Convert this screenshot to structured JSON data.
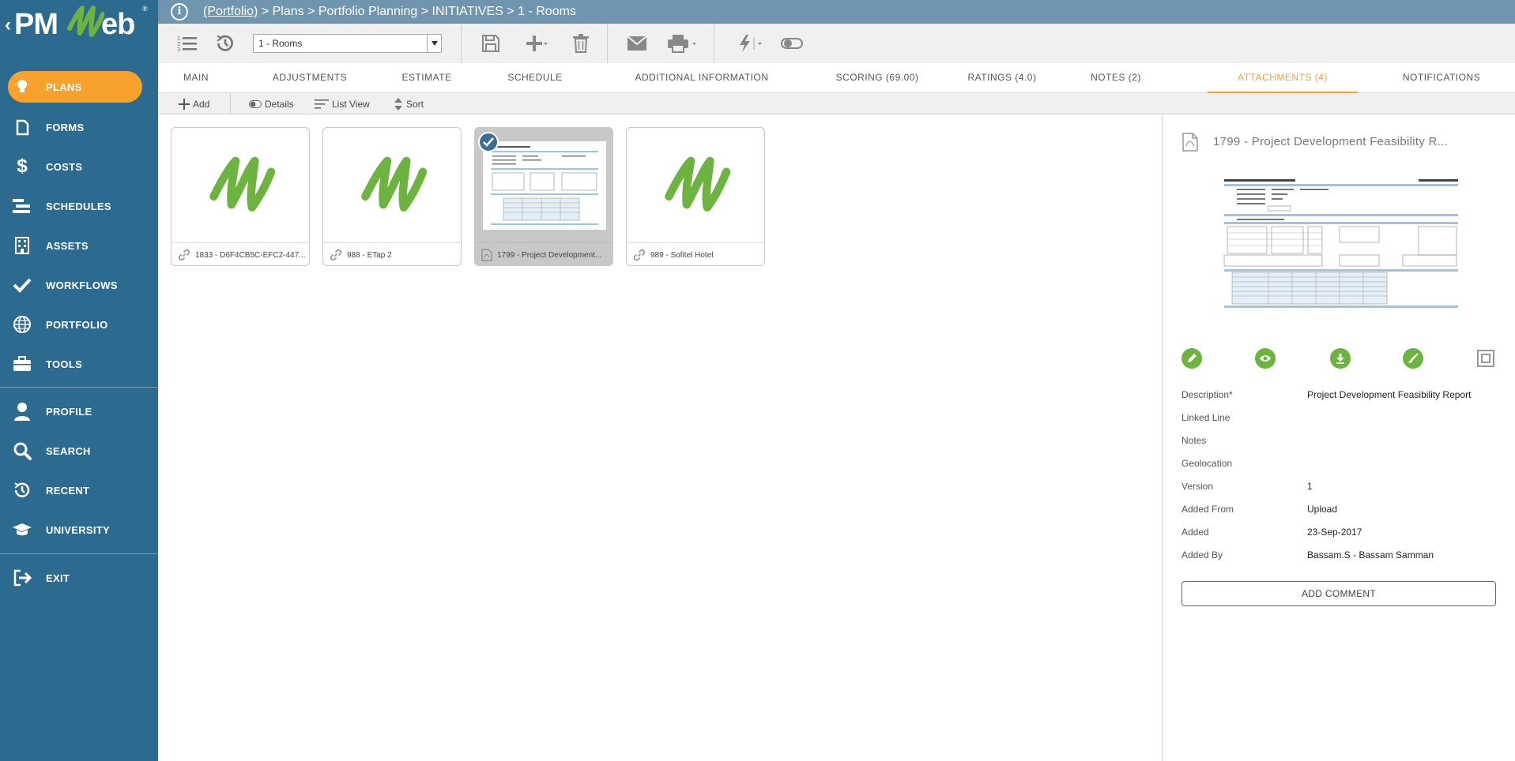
{
  "app": {
    "logo_text_left": "PM",
    "logo_text_right": "eb",
    "logo_reg": "®"
  },
  "sidebar": {
    "items": [
      {
        "label": "PLANS",
        "icon": "lightbulb-icon",
        "active": true
      },
      {
        "label": "FORMS",
        "icon": "document-icon"
      },
      {
        "label": "COSTS",
        "icon": "dollar-icon"
      },
      {
        "label": "SCHEDULES",
        "icon": "gantt-icon"
      },
      {
        "label": "ASSETS",
        "icon": "building-icon"
      },
      {
        "label": "WORKFLOWS",
        "icon": "check-icon"
      },
      {
        "label": "PORTFOLIO",
        "icon": "globe-icon"
      },
      {
        "label": "TOOLS",
        "icon": "toolbox-icon"
      },
      {
        "label": "PROFILE",
        "icon": "user-icon"
      },
      {
        "label": "SEARCH",
        "icon": "search-icon"
      },
      {
        "label": "RECENT",
        "icon": "history-icon"
      },
      {
        "label": "UNIVERSITY",
        "icon": "graduation-cap-icon"
      },
      {
        "label": "EXIT",
        "icon": "exit-icon"
      }
    ]
  },
  "breadcrumb": {
    "link": "(Portfolio)",
    "rest": " > Plans > Portfolio Planning > INITIATIVES > 1 - Rooms"
  },
  "toolbar": {
    "record_selected": "1 - Rooms"
  },
  "tabs": [
    {
      "label": "MAIN"
    },
    {
      "label": "ADJUSTMENTS"
    },
    {
      "label": "ESTIMATE"
    },
    {
      "label": "SCHEDULE"
    },
    {
      "label": "ADDITIONAL INFORMATION"
    },
    {
      "label": "SCORING (69.00)"
    },
    {
      "label": "RATINGS (4.0)"
    },
    {
      "label": "NOTES (2)"
    },
    {
      "label": "ATTACHMENTS (4)",
      "active": true
    },
    {
      "label": "NOTIFICATIONS"
    }
  ],
  "subtoolbar": {
    "add": "Add",
    "details": "Details",
    "list_view": "List View",
    "sort": "Sort"
  },
  "attachments": [
    {
      "name": "1833 - D6F4CB5C-EFC2-447...",
      "type": "link"
    },
    {
      "name": "988 - ETap 2",
      "type": "link"
    },
    {
      "name": "1799 - Project Development...",
      "type": "file",
      "selected": true
    },
    {
      "name": "989 - Sofitel Hotel",
      "type": "link"
    }
  ],
  "details": {
    "title": "1799 - Project Development Feasibility R...",
    "properties": [
      {
        "label": "Description*",
        "value": "Project Development Feasibility Report"
      },
      {
        "label": "Linked Line",
        "value": ""
      },
      {
        "label": "Notes",
        "value": ""
      },
      {
        "label": "Geolocation",
        "value": ""
      },
      {
        "label": "Version",
        "value": "1"
      },
      {
        "label": "Added From",
        "value": "Upload"
      },
      {
        "label": "Added",
        "value": "23-Sep-2017"
      },
      {
        "label": "Added By",
        "value": "Bassam.S - Bassam Samman"
      }
    ],
    "add_comment": "ADD COMMENT"
  },
  "colors": {
    "sidebar": "#2d6a8f",
    "accent": "#f6a22c",
    "action_green": "#6cb33f",
    "crumb_bar": "#6f96ae"
  }
}
